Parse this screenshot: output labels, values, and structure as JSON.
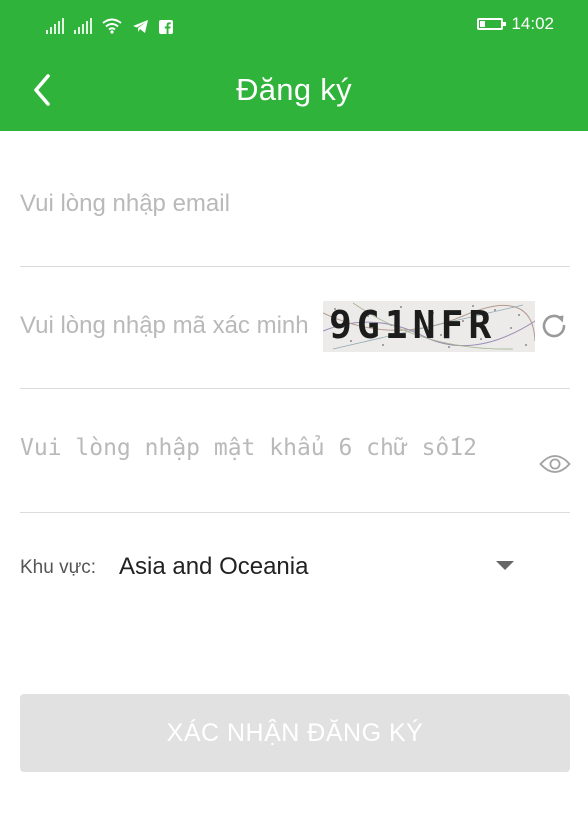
{
  "status_bar": {
    "time": "14:02"
  },
  "header": {
    "title": "Đăng ký",
    "back_icon": "chevron-left-icon"
  },
  "form": {
    "email": {
      "placeholder": "Vui lòng nhập email",
      "value": ""
    },
    "captcha": {
      "placeholder": "Vui lòng nhập mã xác minh",
      "value": "",
      "image_text": "9G1NFR",
      "refresh_icon": "refresh-icon"
    },
    "password": {
      "placeholder": "Vui lòng nhập mật khẩu 6 chữ số12",
      "value": "",
      "toggle_icon": "eye-icon"
    },
    "region": {
      "label": "Khu vực:",
      "value": "Asia and Oceania"
    }
  },
  "submit": {
    "label": "XÁC NHẬN ĐĂNG KÝ"
  },
  "colors": {
    "brand": "#2fb33a",
    "disabled_button": "#e1e1e1",
    "placeholder": "#b9b9b9"
  }
}
